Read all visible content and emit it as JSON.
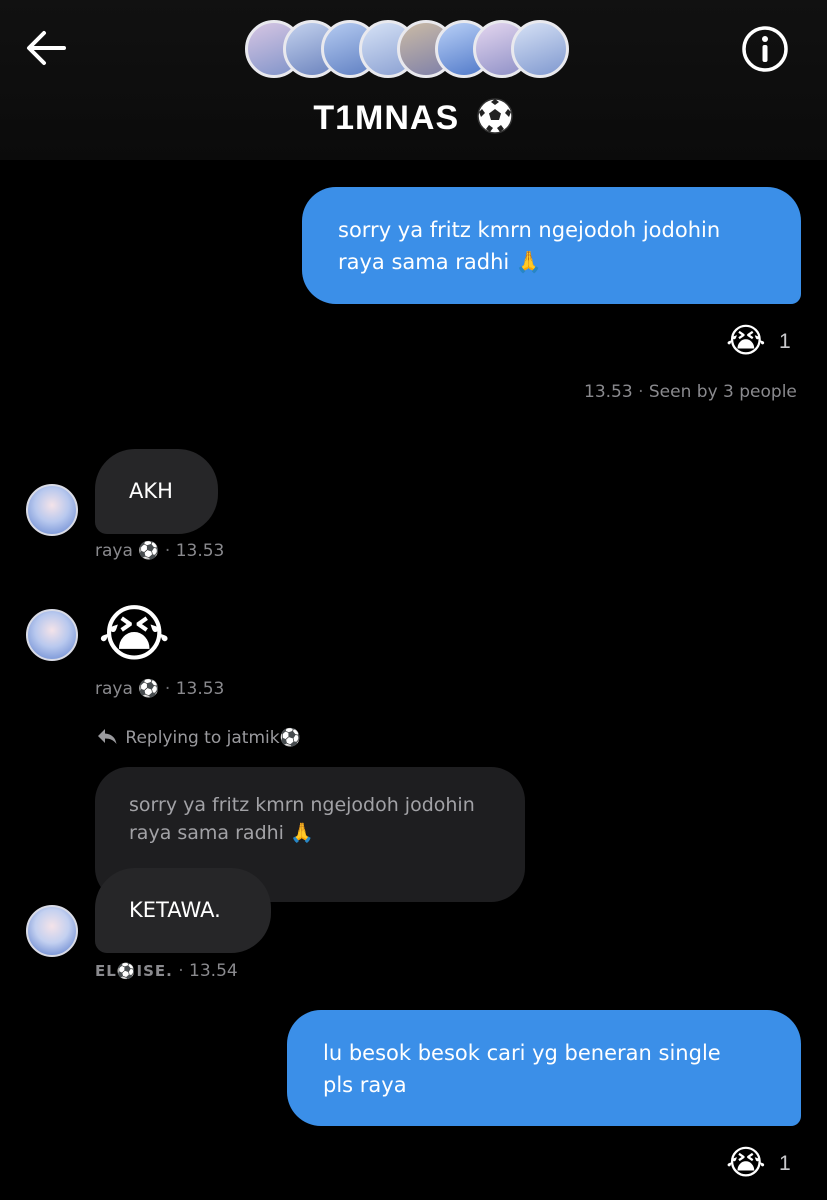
{
  "header": {
    "title": "T1MNAS",
    "title_emoji_icon": "soccer-ball-icon",
    "back_icon": "back-arrow-icon",
    "info_icon": "info-icon",
    "member_avatar_colors": [
      "#c9b7d9",
      "#b6c6e6",
      "#9fb8e8",
      "#c7d6f0",
      "#b9a997",
      "#a7c0f2",
      "#d8c9e7",
      "#cbd8f2"
    ]
  },
  "messages": [
    {
      "direction": "outgoing",
      "text_line1": "sorry ya fritz kmrn ngejodoh jodohin",
      "text_line2": "raya sama radhi 🙏",
      "reaction_emoji": "😭",
      "reaction_count": "1",
      "time": "13.53",
      "seen": "Seen by 3 people"
    },
    {
      "direction": "incoming",
      "text": "AKH",
      "sender": "raya ⚽",
      "time": "13.53"
    },
    {
      "direction": "incoming",
      "emoji": "😭",
      "sender": "raya ⚽",
      "time": "13.53"
    },
    {
      "direction": "incoming",
      "reply_to": "Replying to jatmik⚽",
      "quoted_line1": "sorry ya fritz kmrn ngejodoh jodohin",
      "quoted_line2": "raya sama radhi 🙏",
      "text": "KETAWA.",
      "sender": "EL⚽ISE.",
      "time": "13.54"
    },
    {
      "direction": "outgoing",
      "text_line1": "lu besok besok cari yg beneran single",
      "text_line2": "pls raya",
      "reaction_emoji": "😭",
      "reaction_count": "1"
    }
  ],
  "meta_separator": "·",
  "colors": {
    "outgoing_bubble": "#3b8fe8",
    "incoming_bubble": "#262628",
    "quoted_bubble": "#1e1e20",
    "meta_text": "#8a8a8e"
  }
}
